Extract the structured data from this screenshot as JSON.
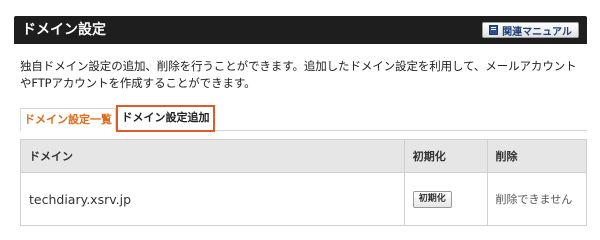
{
  "header": {
    "title": "ドメイン設定",
    "manual_button": "関連マニュアル"
  },
  "description": "独自ドメイン設定の追加、削除を行うことができます。追加したドメイン設定を利用して、メールアカウントやFTPアカウントを作成することができます。",
  "tabs": [
    {
      "label": "ドメイン設定一覧"
    },
    {
      "label": "ドメイン設定追加"
    }
  ],
  "table": {
    "headers": {
      "domain": "ドメイン",
      "init": "初期化",
      "delete": "削除"
    },
    "rows": [
      {
        "domain": "techdiary.xsrv.jp",
        "init_button": "初期化",
        "delete_text": "削除できません"
      }
    ]
  },
  "colors": {
    "header_bg": "#1e1e1e",
    "active_tab_text": "#e06a1a",
    "highlight_border": "#e05a2a",
    "table_header_bg": "#e6e6e6"
  }
}
